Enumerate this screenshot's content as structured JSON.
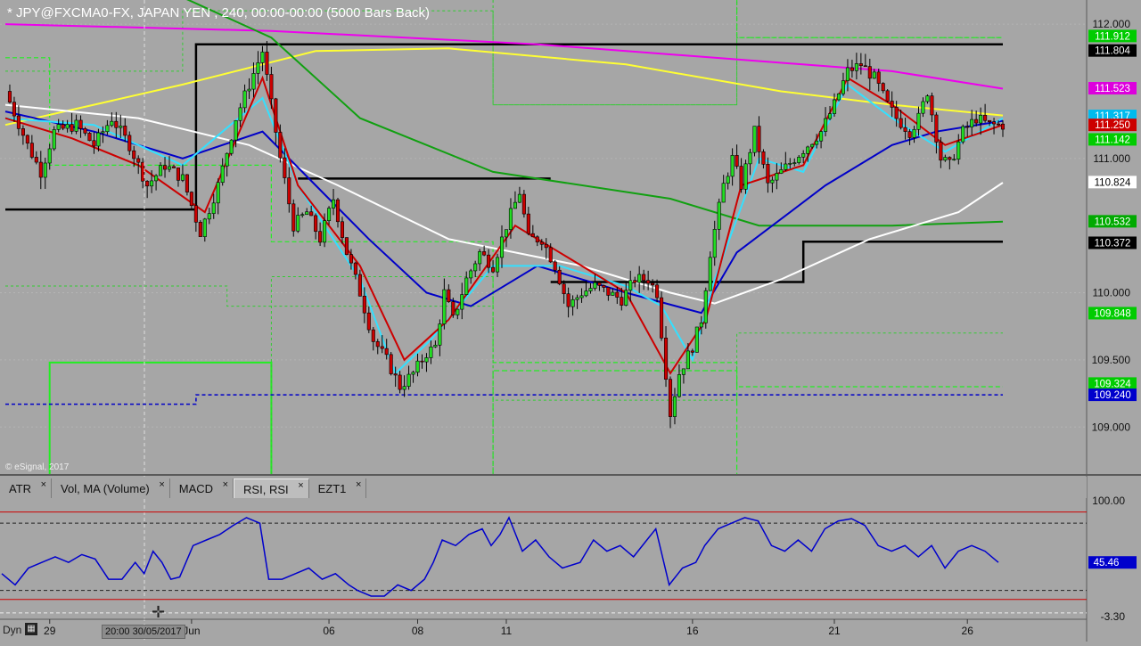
{
  "window": {
    "title": "* JPY@FXCMA0-FX, JAPAN YEN , 240, 00:00-00:00 (5000 Bars Back)",
    "copyright": "© eSignal, 2017",
    "dyn_label": "Dyn",
    "cursor_date": "20:00 30/05/2017"
  },
  "study_tabs": [
    {
      "label": "ATR",
      "active": false
    },
    {
      "label": "Vol, MA (Volume)",
      "active": false
    },
    {
      "label": "MACD",
      "active": false
    },
    {
      "label": "RSI, RSI",
      "active": true
    },
    {
      "label": "EZT1",
      "active": false
    }
  ],
  "icons": {
    "tab_close": "×",
    "dyn": "dyn-icon",
    "cursor": "crosshair-icon"
  },
  "colors": {
    "background": "#a6a6a6",
    "bull": "#22dd22",
    "bear": "#cc0000",
    "ema_red": "#cc0000",
    "ma_blue": "#0000c8",
    "ma_cyan": "#33e0ff",
    "ma_white": "#ffffff",
    "ma_yellow": "#ffff33",
    "ma_magenta": "#ee00ee",
    "ma_green": "#11a011",
    "level_black": "#000000",
    "level_navy": "#0000c8",
    "rsi_line": "#0000cc"
  },
  "chart_data": [
    {
      "type": "candlestick",
      "symbol": "JPY@FXCMA0-FX",
      "interval": "240",
      "x_tick_labels": [
        "29",
        "Jun",
        "06",
        "08",
        "11",
        "16",
        "21",
        "26"
      ],
      "y_tick_labels": [
        "112.000",
        "111.000",
        "110.000",
        "109.500",
        "109.000"
      ],
      "ylim": [
        108.65,
        112.18
      ],
      "price_axis_levels": [
        {
          "label": "111.912",
          "value": 111.912,
          "color": "#00cc00"
        },
        {
          "label": "111.804",
          "value": 111.804,
          "color": "#000000"
        },
        {
          "label": "111.523",
          "value": 111.523,
          "color": "#dd00dd"
        },
        {
          "label": "111.317",
          "value": 111.317,
          "color": "#00bbee"
        },
        {
          "label": "111.250",
          "value": 111.25,
          "color": "#cc0000"
        },
        {
          "label": "111.142",
          "value": 111.142,
          "color": "#00cc00"
        },
        {
          "label": "110.824",
          "value": 110.824,
          "color": "#ffffff"
        },
        {
          "label": "110.532",
          "value": 110.532,
          "color": "#00aa00"
        },
        {
          "label": "110.372",
          "value": 110.372,
          "color": "#000000"
        },
        {
          "label": "109.848",
          "value": 109.848,
          "color": "#00cc00"
        },
        {
          "label": "109.324",
          "value": 109.324,
          "color": "#00cc00"
        },
        {
          "label": "109.240",
          "value": 109.24,
          "color": "#0000cc"
        }
      ],
      "close_path": [
        [
          0,
          111.5
        ],
        [
          5,
          111.1
        ],
        [
          8,
          110.9
        ],
        [
          11,
          111.2
        ],
        [
          16,
          111.25
        ],
        [
          20,
          111.1
        ],
        [
          24,
          111.3
        ],
        [
          28,
          111.1
        ],
        [
          32,
          110.8
        ],
        [
          36,
          110.95
        ],
        [
          40,
          110.85
        ],
        [
          44,
          110.45
        ],
        [
          48,
          110.8
        ],
        [
          52,
          111.3
        ],
        [
          55,
          111.55
        ],
        [
          58,
          111.8
        ],
        [
          60,
          111.4
        ],
        [
          62,
          111.0
        ],
        [
          65,
          110.5
        ],
        [
          68,
          110.6
        ],
        [
          71,
          110.4
        ],
        [
          74,
          110.7
        ],
        [
          77,
          110.3
        ],
        [
          80,
          110.0
        ],
        [
          83,
          109.65
        ],
        [
          86,
          109.5
        ],
        [
          89,
          109.3
        ],
        [
          92,
          109.4
        ],
        [
          95,
          109.55
        ],
        [
          97,
          109.6
        ],
        [
          99,
          110.0
        ],
        [
          101,
          109.8
        ],
        [
          104,
          110.1
        ],
        [
          107,
          110.3
        ],
        [
          110,
          110.2
        ],
        [
          113,
          110.5
        ],
        [
          116,
          110.75
        ],
        [
          118,
          110.4
        ],
        [
          121,
          110.4
        ],
        [
          124,
          110.2
        ],
        [
          127,
          109.9
        ],
        [
          130,
          110.0
        ],
        [
          133,
          110.05
        ],
        [
          136,
          110.0
        ],
        [
          139,
          109.95
        ],
        [
          142,
          110.1
        ],
        [
          145,
          110.1
        ],
        [
          147,
          110.0
        ],
        [
          150,
          109.1
        ],
        [
          152,
          109.4
        ],
        [
          155,
          109.6
        ],
        [
          157,
          109.8
        ],
        [
          159,
          110.3
        ],
        [
          162,
          110.8
        ],
        [
          164,
          111.0
        ],
        [
          166,
          110.8
        ],
        [
          169,
          111.2
        ],
        [
          172,
          110.8
        ],
        [
          175,
          110.9
        ],
        [
          178,
          111.0
        ],
        [
          181,
          111.1
        ],
        [
          184,
          111.2
        ],
        [
          187,
          111.4
        ],
        [
          190,
          111.65
        ],
        [
          193,
          111.7
        ],
        [
          196,
          111.6
        ],
        [
          199,
          111.4
        ],
        [
          201,
          111.3
        ],
        [
          204,
          111.2
        ],
        [
          206,
          111.3
        ],
        [
          208,
          111.5
        ],
        [
          211,
          111.0
        ],
        [
          213,
          110.95
        ],
        [
          216,
          111.2
        ],
        [
          219,
          111.3
        ],
        [
          222,
          111.25
        ],
        [
          225,
          111.25
        ]
      ],
      "moving_averages": [
        {
          "color": "#ee00ee",
          "points": [
            [
              0,
              112.0
            ],
            [
              60,
              111.95
            ],
            [
              120,
              111.85
            ],
            [
              160,
              111.75
            ],
            [
              200,
              111.65
            ],
            [
              225,
              111.52
            ]
          ]
        },
        {
          "color": "#ffff33",
          "points": [
            [
              0,
              111.25
            ],
            [
              40,
              111.55
            ],
            [
              70,
              111.8
            ],
            [
              100,
              111.82
            ],
            [
              140,
              111.7
            ],
            [
              175,
              111.5
            ],
            [
              200,
              111.4
            ],
            [
              225,
              111.32
            ]
          ]
        },
        {
          "color": "#11a011",
          "points": [
            [
              0,
              112.3
            ],
            [
              40,
              112.2
            ],
            [
              60,
              111.9
            ],
            [
              80,
              111.3
            ],
            [
              110,
              110.9
            ],
            [
              150,
              110.7
            ],
            [
              170,
              110.5
            ],
            [
              200,
              110.5
            ],
            [
              225,
              110.53
            ]
          ]
        },
        {
          "color": "#ffffff",
          "points": [
            [
              0,
              111.4
            ],
            [
              30,
              111.3
            ],
            [
              55,
              111.1
            ],
            [
              75,
              110.8
            ],
            [
              100,
              110.4
            ],
            [
              130,
              110.2
            ],
            [
              150,
              110.0
            ],
            [
              160,
              109.92
            ],
            [
              175,
              110.1
            ],
            [
              195,
              110.4
            ],
            [
              215,
              110.6
            ],
            [
              225,
              110.82
            ]
          ]
        },
        {
          "color": "#0000c8",
          "points": [
            [
              0,
              111.35
            ],
            [
              20,
              111.2
            ],
            [
              40,
              111.0
            ],
            [
              58,
              111.2
            ],
            [
              70,
              110.8
            ],
            [
              82,
              110.4
            ],
            [
              95,
              110.0
            ],
            [
              105,
              109.9
            ],
            [
              120,
              110.2
            ],
            [
              140,
              110.0
            ],
            [
              157,
              109.85
            ],
            [
              165,
              110.3
            ],
            [
              185,
              110.8
            ],
            [
              200,
              111.1
            ],
            [
              210,
              111.2
            ],
            [
              225,
              111.28
            ]
          ]
        },
        {
          "color": "#33e0ff",
          "points": [
            [
              0,
              111.3
            ],
            [
              20,
              111.25
            ],
            [
              40,
              110.95
            ],
            [
              58,
              111.45
            ],
            [
              66,
              110.8
            ],
            [
              80,
              110.1
            ],
            [
              88,
              109.4
            ],
            [
              96,
              109.65
            ],
            [
              110,
              110.2
            ],
            [
              125,
              110.2
            ],
            [
              140,
              110.05
            ],
            [
              148,
              109.9
            ],
            [
              155,
              109.5
            ],
            [
              160,
              110.1
            ],
            [
              170,
              111.0
            ],
            [
              180,
              110.9
            ],
            [
              190,
              111.55
            ],
            [
              200,
              111.3
            ],
            [
              212,
              111.05
            ],
            [
              225,
              111.3
            ]
          ]
        },
        {
          "color": "#cc0000",
          "points": [
            [
              0,
              111.3
            ],
            [
              15,
              111.15
            ],
            [
              30,
              110.95
            ],
            [
              45,
              110.6
            ],
            [
              58,
              111.6
            ],
            [
              66,
              110.8
            ],
            [
              80,
              110.2
            ],
            [
              90,
              109.5
            ],
            [
              100,
              109.8
            ],
            [
              115,
              110.5
            ],
            [
              125,
              110.3
            ],
            [
              140,
              110.0
            ],
            [
              150,
              109.4
            ],
            [
              158,
              109.8
            ],
            [
              166,
              110.8
            ],
            [
              180,
              110.95
            ],
            [
              190,
              111.6
            ],
            [
              200,
              111.4
            ],
            [
              212,
              111.1
            ],
            [
              225,
              111.25
            ]
          ]
        }
      ],
      "pivot_levels": [
        {
          "color": "#000000",
          "points": [
            [
              0,
              110.62
            ],
            [
              43,
              110.62
            ],
            [
              43,
              111.85
            ],
            [
              225,
              111.85
            ]
          ]
        },
        {
          "color": "#000000",
          "points": [
            [
              66,
              110.85
            ],
            [
              123,
              110.85
            ]
          ]
        },
        {
          "color": "#000000",
          "points": [
            [
              123,
              110.08
            ],
            [
              180,
              110.08
            ],
            [
              180,
              110.38
            ],
            [
              225,
              110.38
            ]
          ]
        },
        {
          "color": "#0000c8",
          "points": [
            [
              0,
              109.17
            ],
            [
              43,
              109.17
            ],
            [
              43,
              109.24
            ],
            [
              225,
              109.24
            ]
          ]
        }
      ]
    },
    {
      "type": "line",
      "name": "RSI, RSI",
      "y_tick_labels": [
        "100.00",
        "-3.30"
      ],
      "current_label": "45.46",
      "ylim": [
        -3.3,
        100
      ],
      "levels": [
        {
          "value": 90,
          "style": "solid",
          "color": "#cc0000"
        },
        {
          "value": 80,
          "style": "dashed",
          "color": "#222222"
        },
        {
          "value": 20,
          "style": "dashed",
          "color": "#222222"
        },
        {
          "value": 12,
          "style": "solid",
          "color": "#cc0000"
        },
        {
          "value": 0,
          "style": "dashed",
          "color": "#eeeeee"
        }
      ],
      "values": [
        [
          0,
          35
        ],
        [
          3,
          25
        ],
        [
          6,
          40
        ],
        [
          9,
          45
        ],
        [
          12,
          50
        ],
        [
          15,
          45
        ],
        [
          18,
          52
        ],
        [
          21,
          48
        ],
        [
          24,
          30
        ],
        [
          27,
          30
        ],
        [
          30,
          45
        ],
        [
          32,
          35
        ],
        [
          34,
          55
        ],
        [
          36,
          45
        ],
        [
          38,
          30
        ],
        [
          40,
          32
        ],
        [
          43,
          60
        ],
        [
          46,
          65
        ],
        [
          49,
          70
        ],
        [
          52,
          78
        ],
        [
          55,
          85
        ],
        [
          58,
          80
        ],
        [
          60,
          30
        ],
        [
          63,
          30
        ],
        [
          66,
          35
        ],
        [
          69,
          40
        ],
        [
          72,
          30
        ],
        [
          75,
          35
        ],
        [
          78,
          25
        ],
        [
          80,
          20
        ],
        [
          83,
          15
        ],
        [
          86,
          15
        ],
        [
          89,
          25
        ],
        [
          92,
          20
        ],
        [
          95,
          30
        ],
        [
          97,
          45
        ],
        [
          99,
          65
        ],
        [
          102,
          60
        ],
        [
          105,
          70
        ],
        [
          108,
          75
        ],
        [
          110,
          60
        ],
        [
          112,
          70
        ],
        [
          114,
          85
        ],
        [
          117,
          55
        ],
        [
          120,
          65
        ],
        [
          123,
          50
        ],
        [
          126,
          40
        ],
        [
          130,
          45
        ],
        [
          133,
          65
        ],
        [
          136,
          55
        ],
        [
          139,
          60
        ],
        [
          142,
          50
        ],
        [
          145,
          65
        ],
        [
          147,
          75
        ],
        [
          150,
          25
        ],
        [
          153,
          40
        ],
        [
          156,
          45
        ],
        [
          158,
          60
        ],
        [
          161,
          75
        ],
        [
          164,
          80
        ],
        [
          167,
          85
        ],
        [
          170,
          82
        ],
        [
          173,
          60
        ],
        [
          176,
          55
        ],
        [
          179,
          65
        ],
        [
          182,
          55
        ],
        [
          185,
          75
        ],
        [
          188,
          82
        ],
        [
          191,
          84
        ],
        [
          194,
          78
        ],
        [
          197,
          60
        ],
        [
          200,
          55
        ],
        [
          203,
          60
        ],
        [
          206,
          50
        ],
        [
          209,
          60
        ],
        [
          212,
          40
        ],
        [
          215,
          55
        ],
        [
          218,
          60
        ],
        [
          221,
          55
        ],
        [
          224,
          45
        ]
      ]
    }
  ]
}
